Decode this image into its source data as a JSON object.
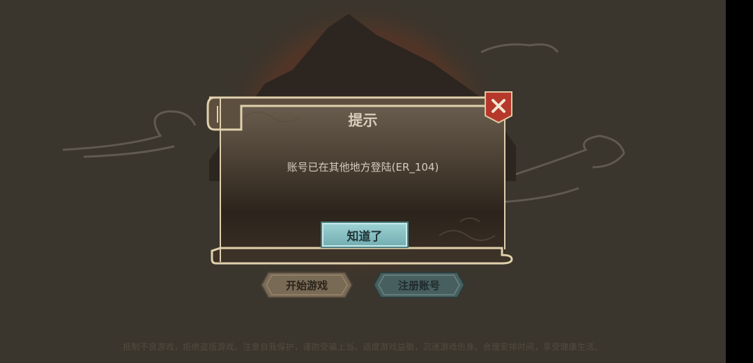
{
  "background": {
    "start_button_label": "开始游戏",
    "register_button_label": "注册账号",
    "footer_notice": "抵制不良游戏，拒绝盗版游戏。注意自我保护，谨防受骗上当。适度游戏益脑，沉迷游戏伤身。合理安排时间，享受健康生活。"
  },
  "dialog": {
    "title": "提示",
    "message": "账号已在其他地方登陆(ER_104)",
    "confirm_label": "知道了",
    "close_icon": "close-x-icon"
  },
  "colors": {
    "backdrop": "#3f3a31",
    "dialog_bg": "#4a3f33",
    "frame_gold": "#d9c9a4",
    "confirm_teal": "#86c2c6",
    "close_red": "#b5382b"
  }
}
